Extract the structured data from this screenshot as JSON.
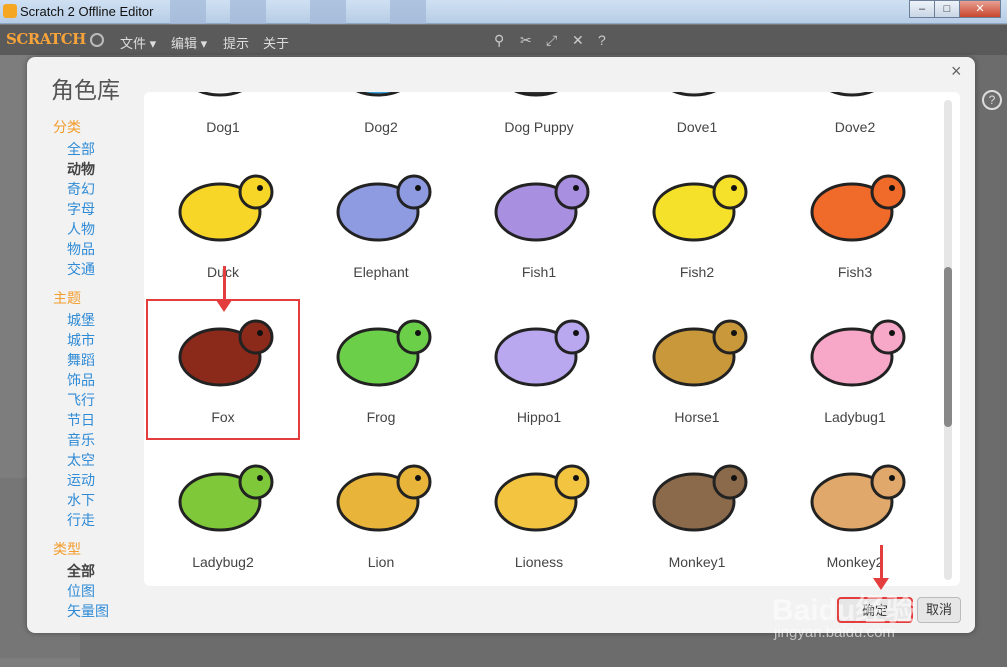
{
  "window": {
    "title": "Scratch 2 Offline Editor",
    "minimize": "–",
    "maximize": "□",
    "close": "✕"
  },
  "menubar": {
    "logo": "SCRATCH",
    "menus": [
      "文件 ▾",
      "编辑 ▾",
      "提示",
      "关于"
    ],
    "icons": [
      "stamp-icon",
      "cut-icon",
      "grow-icon",
      "shrink-icon",
      "help-icon"
    ]
  },
  "dialog": {
    "title": "角色库",
    "close": "×",
    "ok_label": "确定",
    "cancel_label": "取消",
    "categories_heading": "分类",
    "categories": [
      "全部",
      "动物",
      "奇幻",
      "字母",
      "人物",
      "物品",
      "交通"
    ],
    "selected_category": "动物",
    "themes_heading": "主题",
    "themes": [
      "城堡",
      "城市",
      "舞蹈",
      "饰品",
      "飞行",
      "节日",
      "音乐",
      "太空",
      "运动",
      "水下",
      "行走"
    ],
    "types_heading": "类型",
    "types": [
      "全部",
      "位图",
      "矢量图"
    ],
    "selected_type": "全部",
    "sprites": [
      {
        "name": "Dog1",
        "color": "#ffffff"
      },
      {
        "name": "Dog2",
        "color": "#3aa0d8"
      },
      {
        "name": "Dog Puppy",
        "color": "#333333"
      },
      {
        "name": "Dove1",
        "color": "#eeeeee"
      },
      {
        "name": "Dove2",
        "color": "#eeeeee"
      },
      {
        "name": "Duck",
        "color": "#f7d627"
      },
      {
        "name": "Elephant",
        "color": "#8f9be0"
      },
      {
        "name": "Fish1",
        "color": "#a98fe0"
      },
      {
        "name": "Fish2",
        "color": "#f5e02a"
      },
      {
        "name": "Fish3",
        "color": "#f06a2a"
      },
      {
        "name": "Fox",
        "color": "#8b2a1a"
      },
      {
        "name": "Frog",
        "color": "#6ccf4a"
      },
      {
        "name": "Hippo1",
        "color": "#b9a8f0"
      },
      {
        "name": "Horse1",
        "color": "#c9983a"
      },
      {
        "name": "Ladybug1",
        "color": "#f7a8c8"
      },
      {
        "name": "Ladybug2",
        "color": "#7ec83a"
      },
      {
        "name": "Lion",
        "color": "#e8b43a"
      },
      {
        "name": "Lioness",
        "color": "#f3c440"
      },
      {
        "name": "Monkey1",
        "color": "#8a6a4a"
      },
      {
        "name": "Monkey2",
        "color": "#e0a86a"
      }
    ],
    "selected_sprite": "Fox"
  },
  "watermark": {
    "brand": "Baidu经验",
    "url": "jingyan.baidu.com"
  }
}
